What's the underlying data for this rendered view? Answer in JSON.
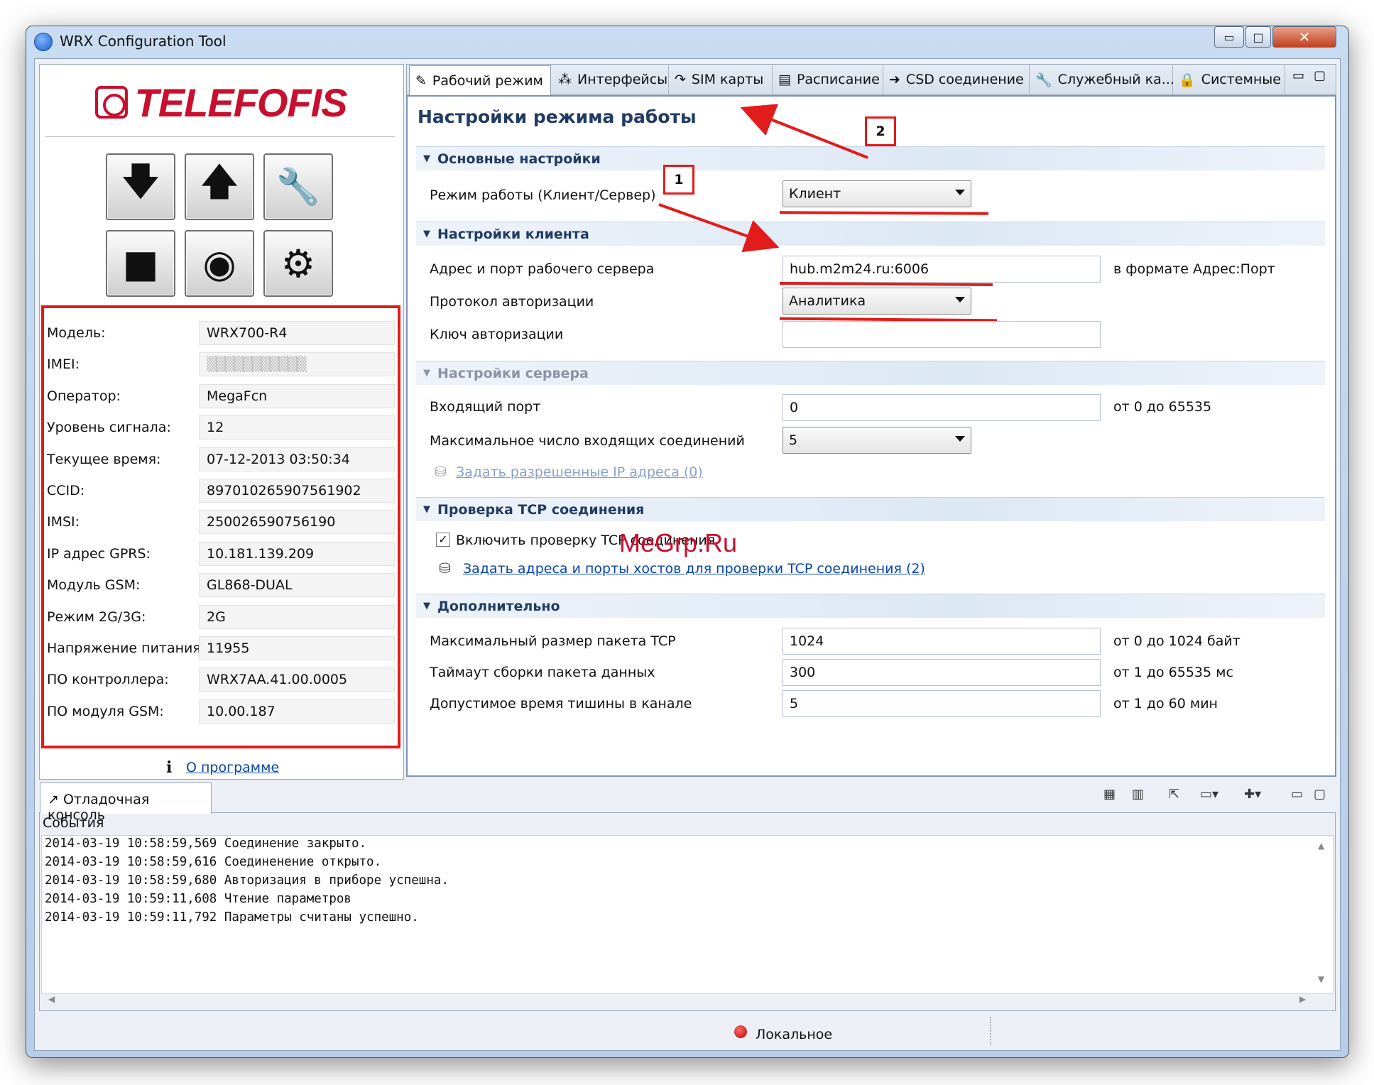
{
  "window": {
    "title": "WRX Configuration Tool",
    "min": "▭",
    "max": "□",
    "close": "✕"
  },
  "logo": {
    "text": "TELEFOFIS"
  },
  "device_info": [
    {
      "label": "Модель:",
      "value": "WRX700-R4"
    },
    {
      "label": "IMEI:",
      "value": "▒▒▒▒▒▒▒▒▒▒▒"
    },
    {
      "label": "Оператор:",
      "value": "MegaFcn"
    },
    {
      "label": "Уровень сигнала:",
      "value": "12"
    },
    {
      "label": "Текущее время:",
      "value": "07-12-2013 03:50:34"
    },
    {
      "label": "CCID:",
      "value": "897010265907561902"
    },
    {
      "label": "IMSI:",
      "value": "250026590756190"
    },
    {
      "label": "IP адрес GPRS:",
      "value": "10.181.139.209"
    },
    {
      "label": "Модуль GSM:",
      "value": "GL868-DUAL"
    },
    {
      "label": "Режим 2G/3G:",
      "value": "2G"
    },
    {
      "label": "Напряжение питания",
      "value": "11955"
    },
    {
      "label": "ПО контроллера:",
      "value": "WRX7AA.41.00.0005"
    },
    {
      "label": "ПО модуля GSM:",
      "value": "10.00.187"
    }
  ],
  "about_link": "О программе",
  "tabs": [
    "Рабочий режим",
    "Интерфейсы",
    "SIM карты",
    "Расписание",
    "CSD соединение",
    "Служебный ка...",
    "Системные"
  ],
  "page_title": "Настройки режима работы",
  "sections": {
    "basic": "Основные настройки",
    "client": "Настройки клиента",
    "server": "Настройки сервера",
    "tcp": "Проверка TCP соединения",
    "extra": "Дополнительно"
  },
  "fields": {
    "mode_label": "Режим работы (Клиент/Сервер)",
    "mode_value": "Клиент",
    "addr_label": "Адрес и порт рабочего сервера",
    "addr_value": "hub.m2m24.ru:6006",
    "addr_hint": "в формате Адрес:Порт",
    "auth_proto_label": "Протокол авторизации",
    "auth_proto_value": "Аналитика",
    "auth_key_label": "Ключ авторизации",
    "auth_key_value": "",
    "in_port_label": "Входящий порт",
    "in_port_value": "0",
    "in_port_hint": "от 0 до 65535",
    "max_conn_label": "Максимальное число входящих соединений",
    "max_conn_value": "5",
    "allowed_ip_link": "Задать разрешенные IP адреса (0)",
    "tcp_check_label": "Включить проверку TCP соединения",
    "tcp_hosts_link": "Задать адреса и порты хостов для проверки TCP соединения (2)",
    "pkt_size_label": "Максимальный размер пакета TCP",
    "pkt_size_value": "1024",
    "pkt_size_hint": "от 0 до 1024 байт",
    "timeout_label": "Таймаут сборки пакета данных",
    "timeout_value": "300",
    "timeout_hint": "от 1 до 65535 мс",
    "silence_label": "Допустимое время тишины в канале",
    "silence_value": "5",
    "silence_hint": "от 1 до 60 мин"
  },
  "annotations": {
    "n1": "1",
    "n2": "2"
  },
  "watermark": "MeGrp.Ru",
  "console": {
    "tab": "Отладочная консоль",
    "label": "События",
    "lines": [
      "2014-03-19 10:58:59,569 Соединение закрыто.",
      "2014-03-19 10:58:59,616 Соединенение открыто.",
      "2014-03-19 10:58:59,680 Авторизация в приборе успешна.",
      "2014-03-19 10:59:11,608 Чтение параметров",
      "2014-03-19 10:59:11,792 Параметры считаны успешно."
    ]
  },
  "status": {
    "text": "Локальное"
  },
  "colors": {
    "accent_red": "#e21b1b",
    "section_text": "#213b63",
    "link": "#0645ad"
  }
}
